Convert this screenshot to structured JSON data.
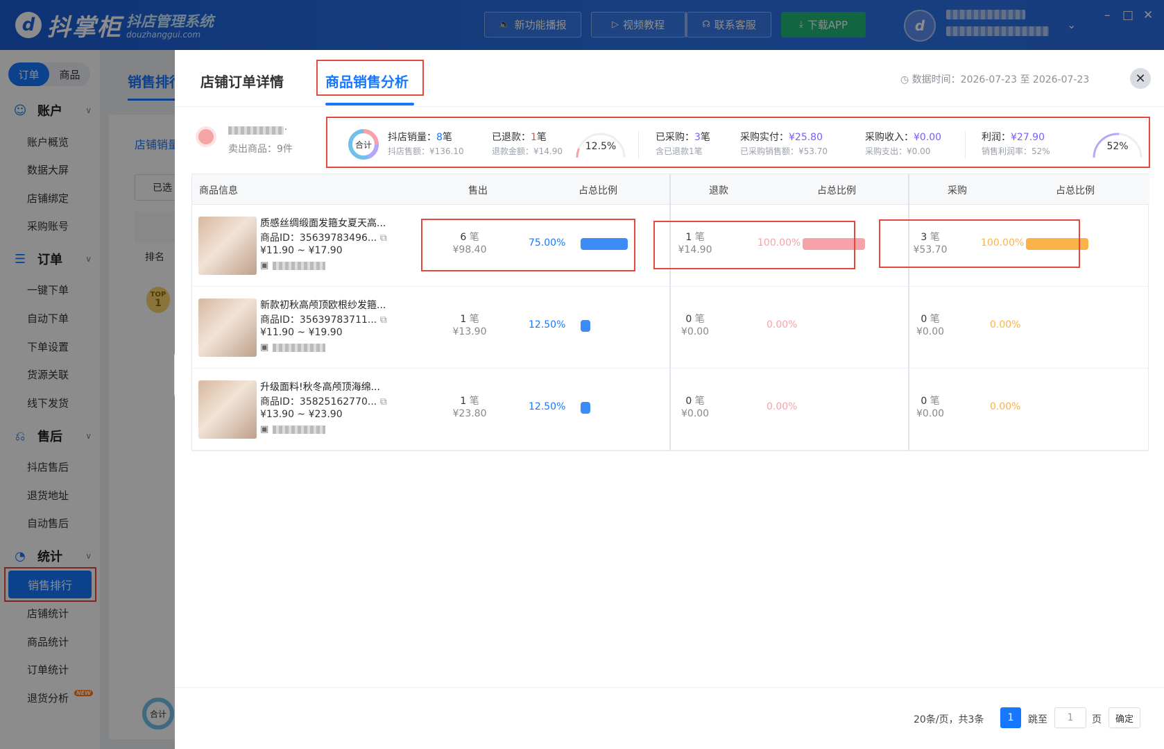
{
  "app": {
    "logo_mark": "d",
    "logo_name": "抖掌柜",
    "logo_subtitle": "抖店管理系统",
    "logo_domain": "douzhanggui.com",
    "logo_avatar": "d"
  },
  "topbar": {
    "buttons": [
      {
        "label": "新功能播报",
        "icon": "speaker-icon"
      },
      {
        "label": "视频教程",
        "icon": "video-icon"
      },
      {
        "label": "联系客服",
        "icon": "headset-icon"
      },
      {
        "label": "下载APP",
        "icon": "download-icon"
      }
    ],
    "window_controls": [
      "–",
      "□",
      "✕"
    ],
    "user_menu_chevron": "⌄"
  },
  "sidebar": {
    "segments": [
      "订单",
      "商品"
    ],
    "sections": [
      {
        "title": "账户",
        "icon": "smile-icon",
        "items": [
          "账户概览",
          "数据大屏",
          "店铺绑定",
          "采购账号"
        ]
      },
      {
        "title": "订单",
        "icon": "list-icon",
        "items": [
          "一键下单",
          "自动下单",
          "下单设置",
          "货源关联",
          "线下发货"
        ]
      },
      {
        "title": "售后",
        "icon": "return-icon",
        "items": [
          "抖店售后",
          "退货地址",
          "自动售后"
        ]
      },
      {
        "title": "统计",
        "icon": "pie-icon",
        "items": [
          "销售排行",
          "店铺统计",
          "商品统计",
          "订单统计",
          "退货分析"
        ]
      }
    ],
    "active_item": "销售排行",
    "new_badge": "NEW"
  },
  "background": {
    "tab": "销售排行",
    "subtab": "店铺销量",
    "filter": "已选",
    "col_rank": "排名",
    "top_badge": "TOP",
    "top_rank": "1",
    "total_badge": "合计"
  },
  "drawer": {
    "tabs": [
      "店铺订单详情",
      "商品销售分析"
    ],
    "active_tab": "商品销售分析",
    "date_label": "数据时间：2026-07-23 至 2026-07-23",
    "close": "✕",
    "expand_arrow": "›"
  },
  "shop": {
    "name_suffix": ".",
    "sold_products": "卖出商品：9件"
  },
  "summary": {
    "total_label": "合计",
    "items": [
      {
        "label": "抖店销量：",
        "value": "8",
        "unit": "笔",
        "sub": "抖店售额：¥136.10"
      },
      {
        "label": "已退款：",
        "value": "1",
        "unit": "笔",
        "sub": "退款金额：¥14.90"
      },
      {
        "label": "已采购：",
        "value": "3",
        "unit": "笔",
        "sub": "含已退款1笔"
      },
      {
        "label": "采购实付：",
        "value": "¥25.80",
        "unit": "",
        "sub": "已采购销售额：¥53.70"
      },
      {
        "label": "采购收入：",
        "value": "¥0.00",
        "unit": "",
        "sub": "采购支出：¥0.00"
      },
      {
        "label": "利润：",
        "value": "¥27.90",
        "unit": "",
        "sub": "销售利润率：52%"
      }
    ],
    "refund_rate": "12.5%",
    "refund_rate_value": 12.5,
    "profit_rate": "52%",
    "profit_rate_value": 52
  },
  "table": {
    "headers": [
      "商品信息",
      "售出",
      "占总比例",
      "退款",
      "占总比例",
      "采购",
      "占总比例"
    ],
    "unit": "笔",
    "rows": [
      {
        "name": "质感丝绸缎面发箍女夏天高...",
        "id": "商品ID：35639783496...",
        "price": "¥11.90 ~ ¥17.90",
        "sold_count": "6",
        "sold_amount": "¥98.40",
        "sold_pct": "75.00%",
        "sold_pct_value": 75,
        "refund_count": "1",
        "refund_amount": "¥14.90",
        "refund_pct": "100.00%",
        "refund_pct_value": 100,
        "purchase_count": "3",
        "purchase_amount": "¥53.70",
        "purchase_pct": "100.00%",
        "purchase_pct_value": 100
      },
      {
        "name": "新款初秋高颅顶欧根纱发箍...",
        "id": "商品ID：35639783711...",
        "price": "¥11.90 ~ ¥19.90",
        "sold_count": "1",
        "sold_amount": "¥13.90",
        "sold_pct": "12.50%",
        "sold_pct_value": 12.5,
        "refund_count": "0",
        "refund_amount": "¥0.00",
        "refund_pct": "0.00%",
        "refund_pct_value": 0,
        "purchase_count": "0",
        "purchase_amount": "¥0.00",
        "purchase_pct": "0.00%",
        "purchase_pct_value": 0
      },
      {
        "name": "升级面料!秋冬高颅顶海绵...",
        "id": "商品ID：35825162770...",
        "price": "¥13.90 ~ ¥23.90",
        "sold_count": "1",
        "sold_amount": "¥23.80",
        "sold_pct": "12.50%",
        "sold_pct_value": 12.5,
        "refund_count": "0",
        "refund_amount": "¥0.00",
        "refund_pct": "0.00%",
        "refund_pct_value": 0,
        "purchase_count": "0",
        "purchase_amount": "¥0.00",
        "purchase_pct": "0.00%",
        "purchase_pct_value": 0
      }
    ]
  },
  "pagination": {
    "per_page": "20条/页，共3条",
    "current": "1",
    "jump_label": "跳至",
    "jump_placeholder": "1",
    "page_unit": "页",
    "confirm": "确定"
  },
  "colors": {
    "primary": "#1677ff",
    "sold_bar": "#3b8cf6",
    "refund_bar": "#f7a1a8",
    "purchase_bar": "#fbb24a",
    "highlight_border": "#e5473a"
  }
}
